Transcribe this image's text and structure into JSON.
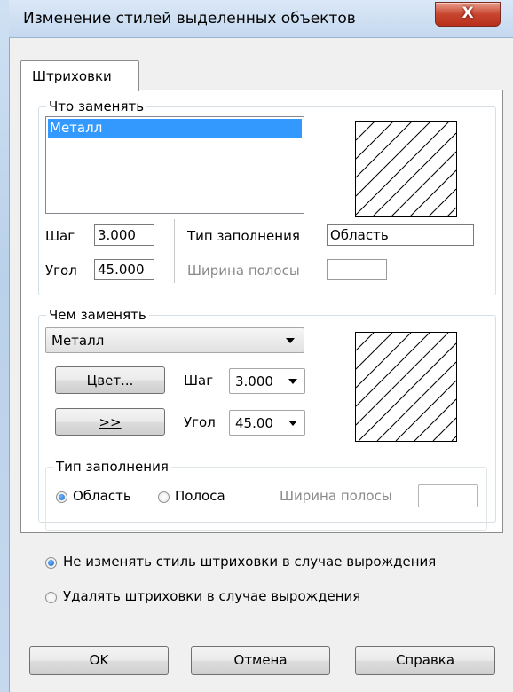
{
  "window": {
    "title": "Изменение стилей выделенных объектов",
    "close_glyph": "X"
  },
  "tab": {
    "label": "Штриховки"
  },
  "replace_what": {
    "group_label": "Что заменять",
    "list_items": [
      "Металл"
    ],
    "step_label": "Шаг",
    "step_value": "3.000",
    "angle_label": "Угол",
    "angle_value": "45.000",
    "fill_type_label": "Тип заполнения",
    "fill_type_value": "Область",
    "band_width_label": "Ширина полосы",
    "band_width_value": ""
  },
  "replace_with": {
    "group_label": "Чем заменять",
    "style_value": "Металл",
    "color_button": "Цвет...",
    "copy_button": ">>",
    "step_label": "Шаг",
    "step_value": "3.000",
    "angle_label": "Угол",
    "angle_value": "45.00",
    "fill_group_label": "Тип заполнения",
    "radio_area": "Область",
    "radio_band": "Полоса",
    "band_width_label": "Ширина полосы",
    "band_width_value": "",
    "selected_fill": "Область"
  },
  "degenerate_options": {
    "keep_style": "Не изменять стиль штриховки в случае вырождения",
    "delete_hatch": "Удалять штриховки в случае вырождения",
    "selected": "keep_style"
  },
  "footer": {
    "ok": "OK",
    "cancel": "Отмена",
    "help": "Справка"
  },
  "colors": {
    "selection": "#3399ff",
    "close_button": "#c8452e",
    "titlebar": "#c4d8ef"
  }
}
